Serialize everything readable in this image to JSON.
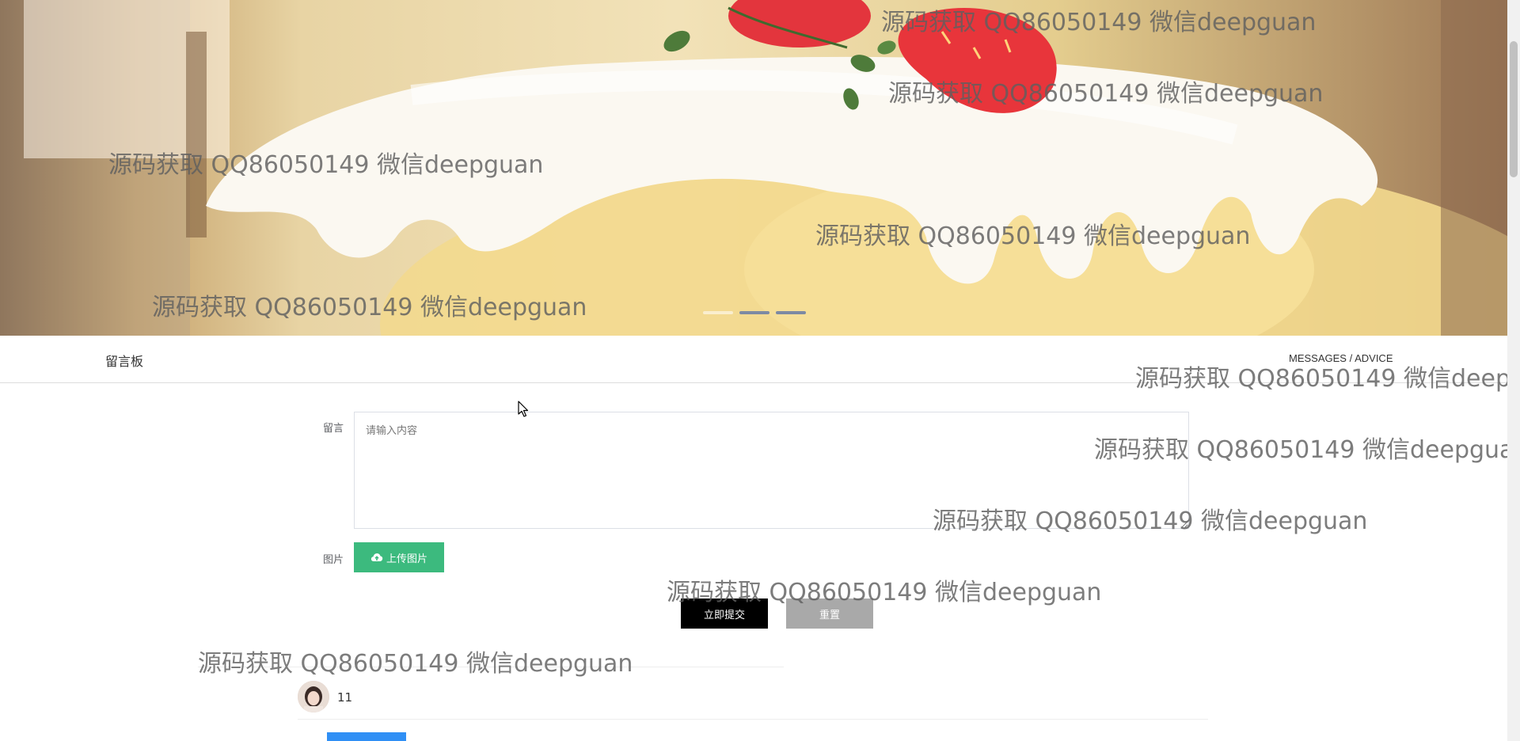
{
  "banner": {
    "carousel": {
      "slide_count": 3,
      "active_index": 1
    }
  },
  "section": {
    "title": "留言板",
    "subtitle": "MESSAGES / ADVICE"
  },
  "form": {
    "message_label": "留言",
    "message_placeholder": "请输入内容",
    "image_label": "图片",
    "upload_button": "上传图片",
    "submit_button": "立即提交",
    "reset_button": "重置"
  },
  "messages": [
    {
      "text": "11"
    }
  ],
  "watermark_text": "源码获取 QQ86050149 微信deepguan",
  "colors": {
    "upload_green": "#3cba7e",
    "submit_black": "#000000",
    "reset_gray": "#a9a9a9",
    "reply_blue": "#2f8ff5"
  },
  "icons": {
    "upload": "cloud-upload-icon",
    "cursor": "mouse-pointer-icon"
  }
}
